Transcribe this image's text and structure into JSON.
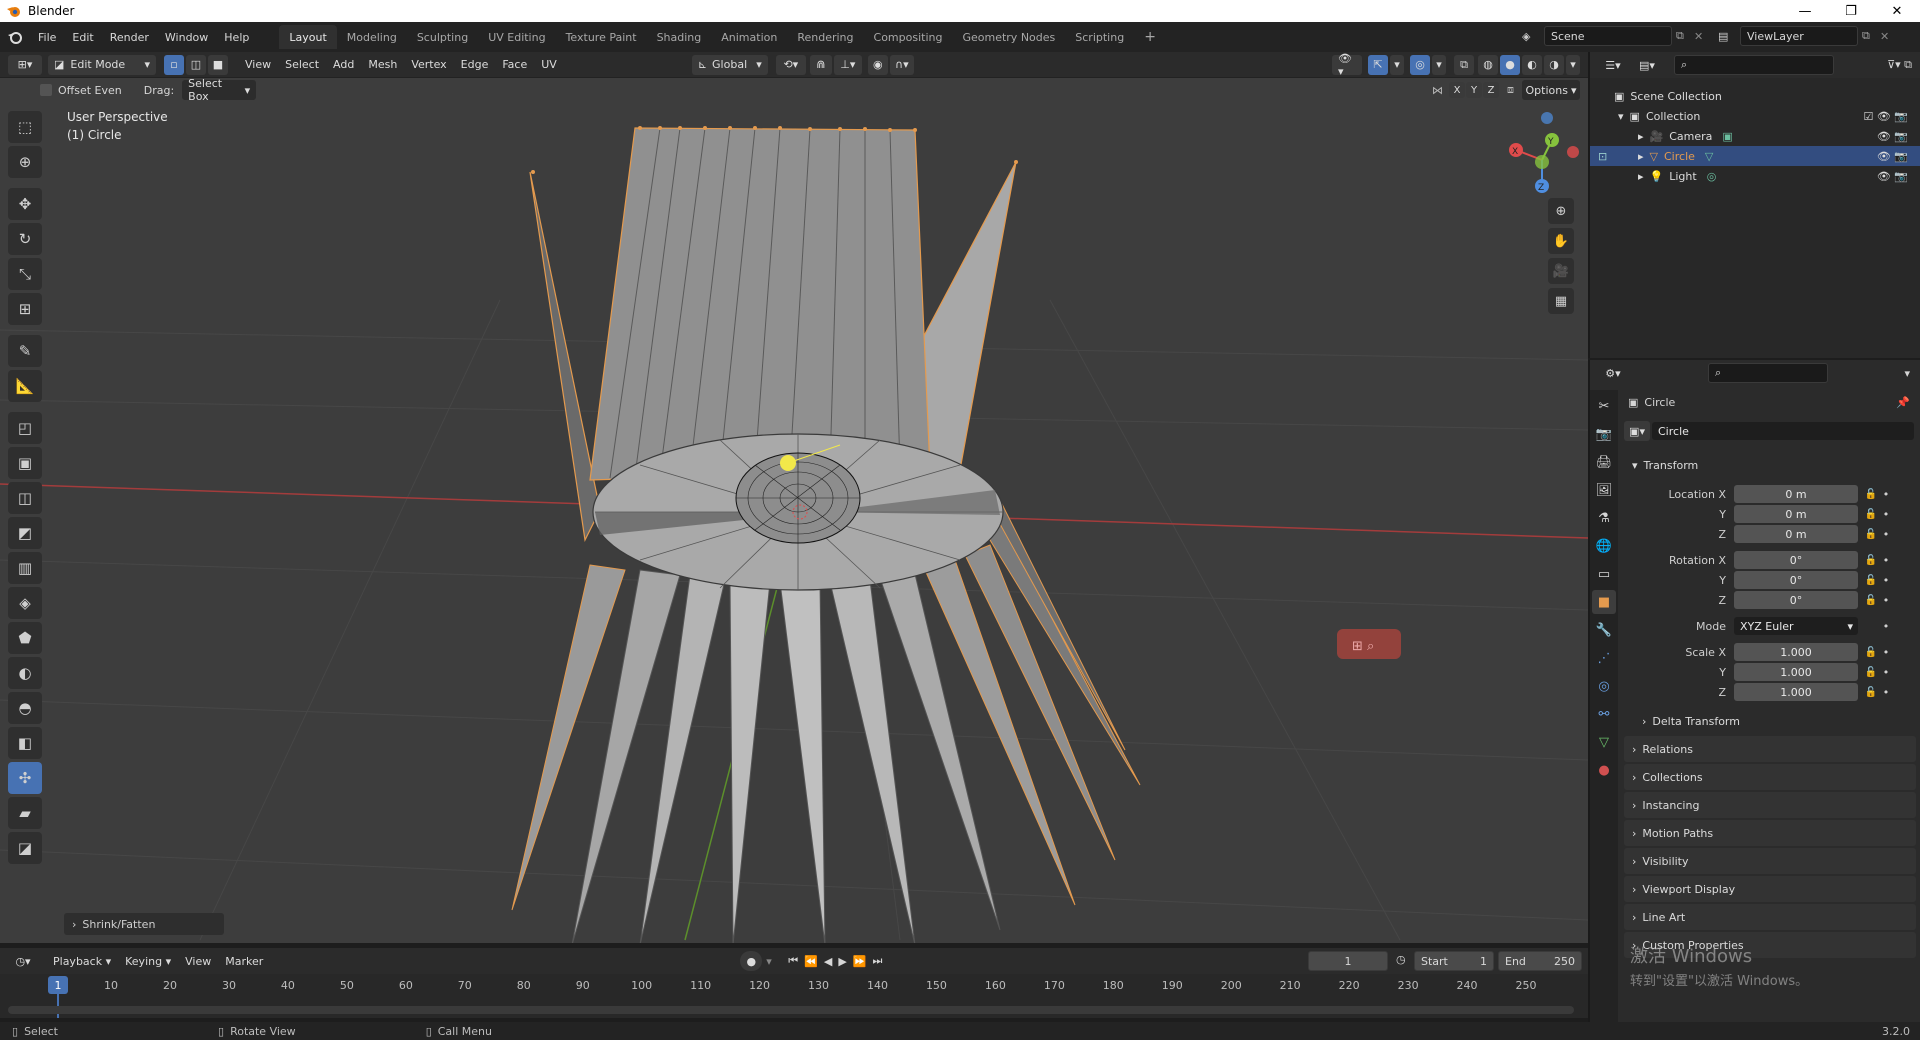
{
  "window": {
    "title": "Blender",
    "minimize": "—",
    "maximize": "❐",
    "close": "✕"
  },
  "menus": [
    "File",
    "Edit",
    "Render",
    "Window",
    "Help"
  ],
  "workspaces": [
    "Layout",
    "Modeling",
    "Sculpting",
    "UV Editing",
    "Texture Paint",
    "Shading",
    "Animation",
    "Rendering",
    "Compositing",
    "Geometry Nodes",
    "Scripting"
  ],
  "add_workspace": "+",
  "scene": {
    "label": "Scene",
    "viewlayer": "ViewLayer"
  },
  "viewport_header": {
    "mode": "Edit Mode",
    "menus": [
      "View",
      "Select",
      "Add",
      "Mesh",
      "Vertex",
      "Edge",
      "Face",
      "UV"
    ],
    "orientation": "Global",
    "options": "Options",
    "axes": [
      "X",
      "Y",
      "Z"
    ]
  },
  "tool_settings": {
    "offset_even": "Offset Even",
    "drag_label": "Drag:",
    "drag_value": "Select Box"
  },
  "viewport": {
    "perspective": "User Perspective",
    "object": "(1) Circle",
    "operator_panel": "Shrink/Fatten"
  },
  "gizmo": {
    "x": "X",
    "y": "Y",
    "z": "Z"
  },
  "timeline": {
    "menus": [
      "Playback",
      "Keying",
      "View",
      "Marker"
    ],
    "current_frame": "1",
    "start_label": "Start",
    "start": "1",
    "end_label": "End",
    "end": "250",
    "ticks": [
      "1",
      "10",
      "20",
      "30",
      "40",
      "50",
      "60",
      "70",
      "80",
      "90",
      "100",
      "110",
      "120",
      "130",
      "140",
      "150",
      "160",
      "170",
      "180",
      "190",
      "200",
      "210",
      "220",
      "230",
      "240",
      "250"
    ]
  },
  "status": {
    "select": "Select",
    "rotate": "Rotate View",
    "call_menu": "Call Menu",
    "version": "3.2.0"
  },
  "outliner": {
    "scene_collection": "Scene Collection",
    "collection": "Collection",
    "items": [
      {
        "name": "Camera",
        "color": "#e49a4e"
      },
      {
        "name": "Circle",
        "color": "#e49a4e"
      },
      {
        "name": "Light",
        "color": "#e49a4e"
      }
    ]
  },
  "properties": {
    "object_name": "Circle",
    "data_name": "Circle",
    "transform": "Transform",
    "location": {
      "label": "Location X",
      "x": "0 m",
      "y": "0 m",
      "z": "0 m"
    },
    "rotation": {
      "label": "Rotation X",
      "x": "0°",
      "y": "0°",
      "z": "0°"
    },
    "mode": {
      "label": "Mode",
      "value": "XYZ Euler"
    },
    "scale": {
      "label": "Scale X",
      "x": "1.000",
      "y": "1.000",
      "z": "1.000"
    },
    "axis_y": "Y",
    "axis_z": "Z",
    "delta": "Delta Transform",
    "panels": [
      "Relations",
      "Collections",
      "Instancing",
      "Motion Paths",
      "Visibility",
      "Viewport Display",
      "Line Art",
      "Custom Properties"
    ]
  },
  "watermark": {
    "line1": "激活 Windows",
    "line2": "转到\"设置\"以激活 Windows。"
  },
  "colors": {
    "accent": "#4772b3",
    "selection": "#e49a4e",
    "x_axis": "#e04b4b",
    "y_axis": "#86c23d",
    "z_axis": "#4f8ee0"
  }
}
